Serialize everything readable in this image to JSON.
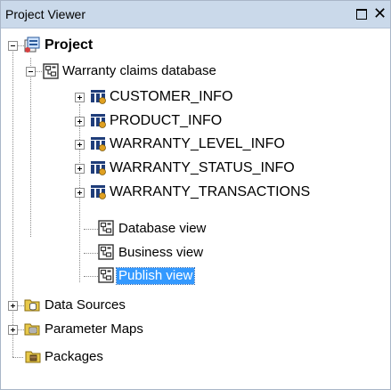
{
  "panel": {
    "title": "Project Viewer",
    "maximize_glyph": "□",
    "close_glyph": "✕"
  },
  "tree": {
    "project": {
      "label": "Project",
      "icon": "project-icon",
      "expanded": true
    },
    "namespace": {
      "label": "Warranty claims database",
      "icon": "namespace-icon",
      "expanded": true
    },
    "tables": [
      {
        "label": "CUSTOMER_INFO",
        "icon": "query-subject-icon",
        "expanded": false
      },
      {
        "label": "PRODUCT_INFO",
        "icon": "query-subject-icon",
        "expanded": false
      },
      {
        "label": "WARRANTY_LEVEL_INFO",
        "icon": "query-subject-icon",
        "expanded": false
      },
      {
        "label": "WARRANTY_STATUS_INFO",
        "icon": "query-subject-icon",
        "expanded": false
      },
      {
        "label": "WARRANTY_TRANSACTIONS",
        "icon": "query-subject-icon",
        "expanded": false
      }
    ],
    "views": [
      {
        "label": "Database view",
        "icon": "namespace-icon",
        "selected": false
      },
      {
        "label": "Business view",
        "icon": "namespace-icon",
        "selected": false
      },
      {
        "label": "Publish view",
        "icon": "namespace-icon",
        "selected": true
      }
    ],
    "folders": [
      {
        "label": "Data Sources",
        "icon": "data-sources-folder-icon",
        "expandable": true
      },
      {
        "label": "Parameter Maps",
        "icon": "parameter-maps-folder-icon",
        "expandable": true
      },
      {
        "label": "Packages",
        "icon": "packages-folder-icon",
        "expandable": false
      }
    ]
  },
  "colors": {
    "titlebar": "#cad9ea",
    "selection": "#3399ff",
    "folder": "#e8c94a"
  }
}
